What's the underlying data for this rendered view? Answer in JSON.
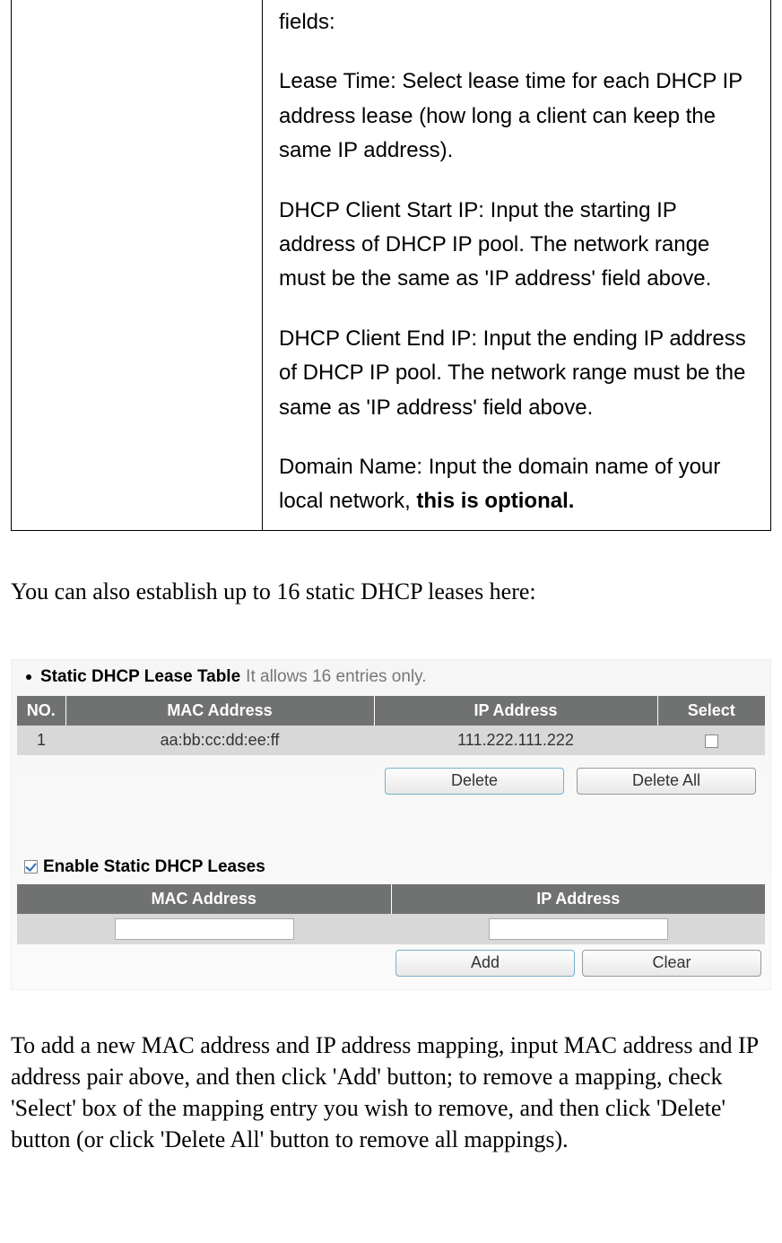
{
  "desc": {
    "first": "fields:",
    "lease": "Lease Time: Select lease time for each DHCP IP address lease (how long a client can keep the same IP address).",
    "start": "DHCP Client Start IP: Input the starting IP address of DHCP IP pool. The network range must be the same as 'IP address' field above.",
    "end": "DHCP Client End IP: Input the ending IP address of DHCP IP pool. The network range must be the same as 'IP address' field above.",
    "domain_prefix": "Domain Name: Input the domain name of your local network, ",
    "domain_bold": "this is optional."
  },
  "body1": "You can also establish up to 16 static DHCP leases here:",
  "screenshot": {
    "heading_title": "Static DHCP Lease Table",
    "heading_sub": "It allows 16 entries only.",
    "table1": {
      "headers": {
        "no": "NO.",
        "mac": "MAC Address",
        "ip": "IP Address",
        "select": "Select"
      },
      "row": {
        "no": "1",
        "mac": "aa:bb:cc:dd:ee:ff",
        "ip": "111.222.111.222"
      }
    },
    "buttons": {
      "delete": "Delete",
      "delete_all": "Delete All",
      "add": "Add",
      "clear": "Clear"
    },
    "enable_label": "Enable Static DHCP Leases",
    "table2": {
      "headers": {
        "mac": "MAC Address",
        "ip": "IP Address"
      },
      "inputs": {
        "mac": "",
        "ip": ""
      }
    }
  },
  "body2": "To add a new MAC address and IP address mapping, input MAC address and IP address pair above, and then click 'Add' button; to remove a mapping, check 'Select' box of the mapping entry you wish to remove, and then click 'Delete' button (or click 'Delete All' button to remove all mappings)."
}
